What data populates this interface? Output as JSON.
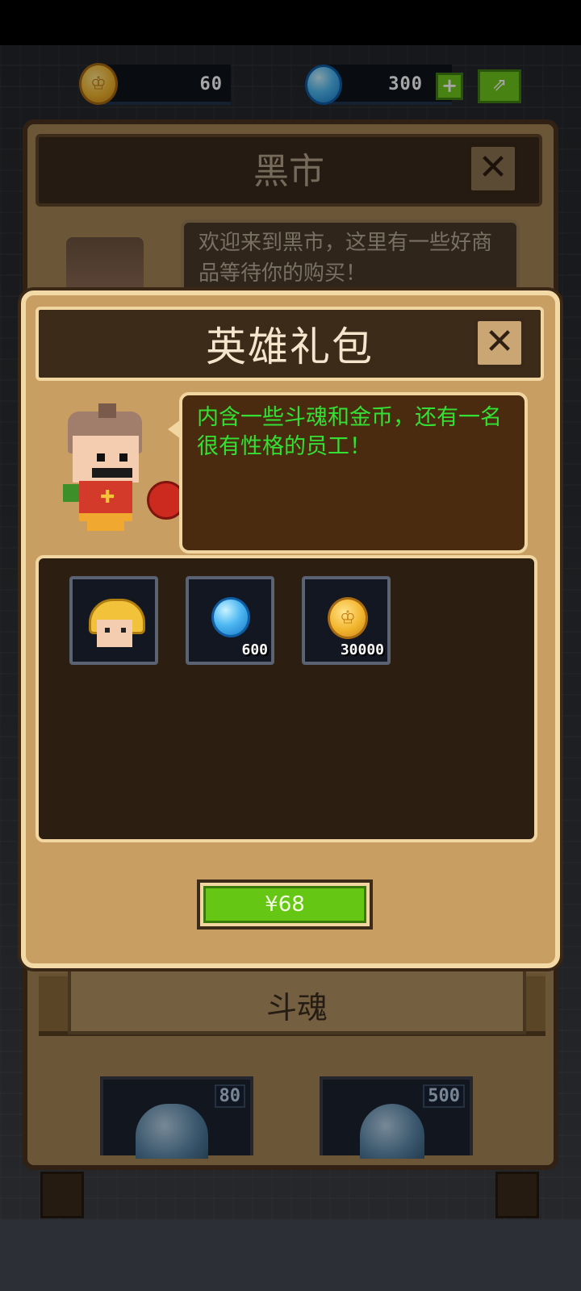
{
  "currency": {
    "coins": "60",
    "gems": "300",
    "add_label": "+",
    "share_icon": "share-icon"
  },
  "black_market": {
    "title": "黑市",
    "greeting": "欢迎来到黑市，这里有一些好商品等待你的购买！",
    "section_title": "斗魂",
    "items": [
      {
        "price": "80",
        "icon": "soul-small-icon"
      },
      {
        "price": "500",
        "icon": "soul-bag-icon"
      }
    ]
  },
  "gift_pack": {
    "title": "英雄礼包",
    "description": "内含一些斗魂和金币，还有一名很有性格的员工！",
    "contents": [
      {
        "icon": "hero-portrait-icon",
        "count": ""
      },
      {
        "icon": "gem-icon",
        "count": "600"
      },
      {
        "icon": "coin-icon",
        "count": "30000"
      }
    ],
    "buy_label": "¥68"
  },
  "colors": {
    "accent_green": "#66c614",
    "bubble_text": "#33e033",
    "panel_tan": "#c99e62"
  }
}
